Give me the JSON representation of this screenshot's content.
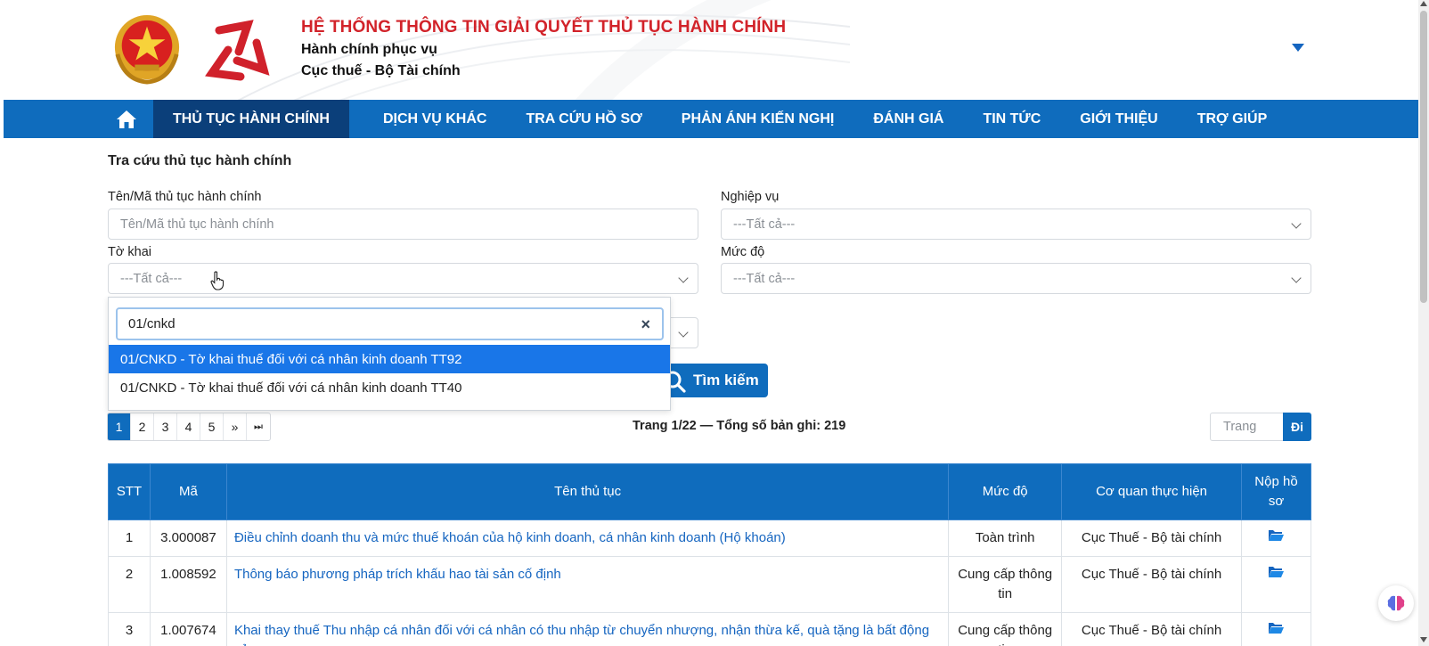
{
  "header": {
    "title": "HỆ THỐNG THÔNG TIN GIẢI QUYẾT THỦ TỤC HÀNH CHÍNH",
    "subtitle1": "Hành chính phục vụ",
    "subtitle2": "Cục thuế - Bộ Tài chính"
  },
  "nav": {
    "items": [
      "THỦ TỤC HÀNH CHÍNH",
      "DỊCH VỤ KHÁC",
      "TRA CỨU HỒ SƠ",
      "PHẢN ÁNH KIẾN NGHỊ",
      "ĐÁNH GIÁ",
      "TIN TỨC",
      "GIỚI THIỆU",
      "TRỢ GIÚP"
    ]
  },
  "search": {
    "section_title": "Tra cứu thủ tục hành chính",
    "name_label": "Tên/Mã thủ tục hành chính",
    "name_placeholder": "Tên/Mã thủ tục hành chính",
    "business_label": "Nghiệp vụ",
    "business_value": "---Tất cả---",
    "form_label": "Tờ khai",
    "form_value": "---Tất cả---",
    "level_label": "Mức độ",
    "level_value": "---Tất cả---",
    "search_button": "Tìm kiếm"
  },
  "dropdown": {
    "query": "01/cnkd",
    "clear": "×",
    "options": [
      "01/CNKD - Tờ khai thuế đối với cá nhân kinh doanh TT92",
      "01/CNKD - Tờ khai thuế đối với cá nhân kinh doanh TT40"
    ]
  },
  "pagination": {
    "pages": [
      "1",
      "2",
      "3",
      "4",
      "5",
      "»",
      "⏭"
    ],
    "info": "Trang 1/22 — Tổng số bản ghi: 219",
    "goto_placeholder": "Trang",
    "goto_button": "Đi"
  },
  "table": {
    "headers": [
      "STT",
      "Mã",
      "Tên thủ tục",
      "Mức độ",
      "Cơ quan thực hiện",
      "Nộp hồ sơ"
    ],
    "rows": [
      {
        "stt": "1",
        "code": "3.000087",
        "name": "Điều chỉnh doanh thu và mức thuế khoán của hộ kinh doanh, cá nhân kinh doanh (Hộ khoán)",
        "level": "Toàn trình",
        "agency": "Cục Thuế - Bộ tài chính"
      },
      {
        "stt": "2",
        "code": "1.008592",
        "name": "Thông báo phương pháp trích khấu hao tài sản cố định",
        "level": "Cung cấp thông tin",
        "agency": "Cục Thuế - Bộ tài chính"
      },
      {
        "stt": "3",
        "code": "1.007674",
        "name": "Khai thay thuế Thu nhập cá nhân đối với cá nhân có thu nhập từ chuyển nhượng, nhận thừa kế, quà tặng là bất động sản",
        "level": "Cung cấp thông tin",
        "agency": "Cục Thuế - Bộ tài chính"
      }
    ]
  },
  "colors": {
    "primary": "#0f6cbd",
    "nav_active": "#0b3f7a",
    "title_red": "#d2232a",
    "option_selected": "#1976e8"
  }
}
